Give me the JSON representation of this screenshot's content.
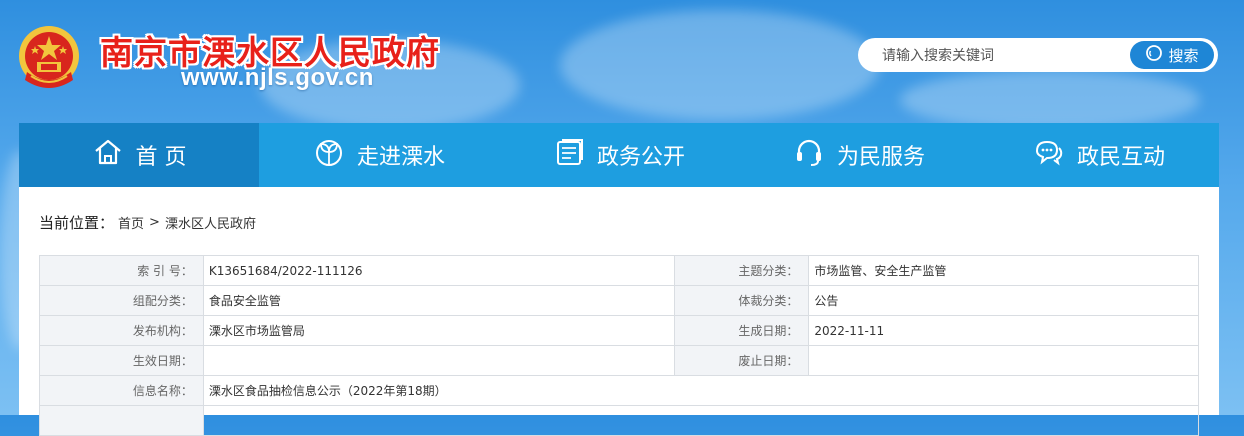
{
  "header": {
    "site_title": "南京市溧水区人民政府",
    "site_url": "www.njls.gov.cn",
    "search": {
      "placeholder": "请输入搜索关键词",
      "button_label": "搜索"
    }
  },
  "nav": {
    "items": [
      {
        "label": "首 页",
        "icon": "home-icon",
        "active": true
      },
      {
        "label": "走进溧水",
        "icon": "sprout-icon",
        "active": false
      },
      {
        "label": "政务公开",
        "icon": "document-icon",
        "active": false
      },
      {
        "label": "为民服务",
        "icon": "headset-icon",
        "active": false
      },
      {
        "label": "政民互动",
        "icon": "chat-icon",
        "active": false
      }
    ]
  },
  "breadcrumb": {
    "label": "当前位置：",
    "items": [
      "首页",
      "溧水区人民政府"
    ],
    "separator": ">"
  },
  "info_table": {
    "rows": [
      {
        "l1": "索 引 号：",
        "v1": "K13651684/2022-111126",
        "l2": "主题分类：",
        "v2": "市场监管、安全生产监管"
      },
      {
        "l1": "组配分类：",
        "v1": "食品安全监管",
        "l2": "体裁分类：",
        "v2": "公告"
      },
      {
        "l1": "发布机构：",
        "v1": "溧水区市场监管局",
        "l2": "生成日期：",
        "v2": "2022-11-11"
      },
      {
        "l1": "生效日期：",
        "v1": "",
        "l2": "废止日期：",
        "v2": ""
      },
      {
        "l1": "信息名称：",
        "v1": "溧水区食品抽检信息公示（2022年第18期）"
      }
    ]
  },
  "colors": {
    "title_red": "#e8211a",
    "nav_blue": "#1e9ee0",
    "nav_active": "#1581c5",
    "search_button": "#1e86d6"
  }
}
